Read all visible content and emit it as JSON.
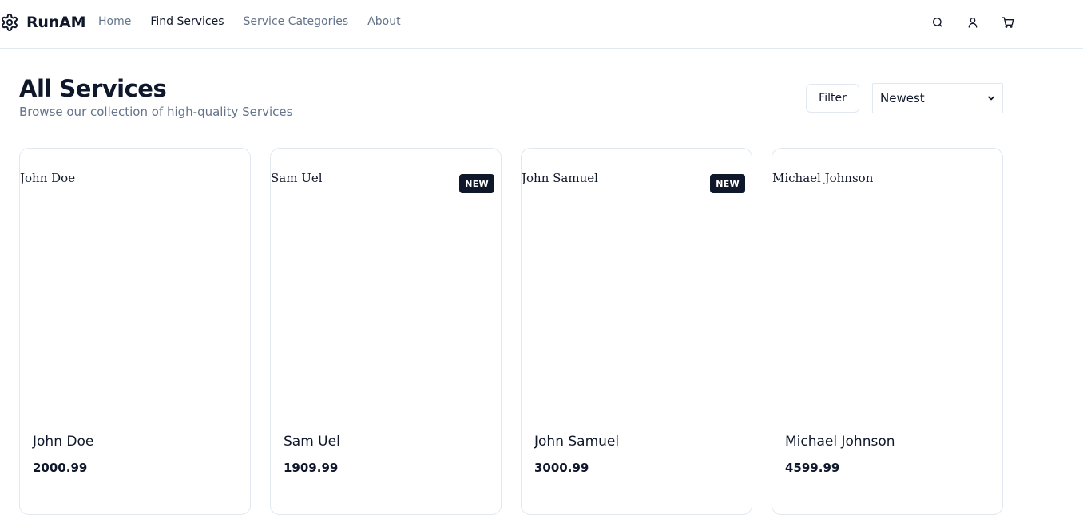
{
  "brand": {
    "name": "RunAM",
    "icon": "gear-icon"
  },
  "nav": {
    "links": [
      {
        "label": "Home",
        "active": false
      },
      {
        "label": "Find Services",
        "active": true
      },
      {
        "label": "Service Categories",
        "active": false
      },
      {
        "label": "About",
        "active": false
      }
    ],
    "actions": [
      "search-icon",
      "user-icon",
      "cart-icon"
    ]
  },
  "page": {
    "title": "All Services",
    "subtitle": "Browse our collection of high-quality Services"
  },
  "toolbar": {
    "filter_label": "Filter",
    "sort_selected": "Newest"
  },
  "services": [
    {
      "image_alt": "John Doe",
      "name": "John Doe",
      "price": "2000.99",
      "badge": ""
    },
    {
      "image_alt": "Sam Uel",
      "name": "Sam Uel",
      "price": "1909.99",
      "badge": "NEW"
    },
    {
      "image_alt": "John Samuel",
      "name": "John Samuel",
      "price": "3000.99",
      "badge": "NEW"
    },
    {
      "image_alt": "Michael Johnson",
      "name": "Michael Johnson",
      "price": "4599.99",
      "badge": ""
    }
  ],
  "colors": {
    "text": "#0f172a",
    "muted": "#64748b",
    "border": "#e2e8f0",
    "badge_bg": "#0f172a",
    "badge_text": "#ffffff"
  }
}
